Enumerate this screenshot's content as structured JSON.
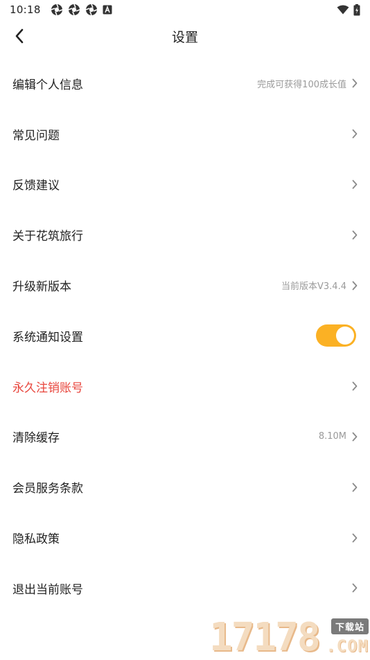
{
  "status_bar": {
    "time": "10:18",
    "left_icons": [
      "aperture-icon",
      "aperture-icon",
      "aperture-icon",
      "a-square-icon"
    ],
    "right_icons": [
      "wifi-icon",
      "battery-charging-icon"
    ]
  },
  "nav": {
    "title": "设置"
  },
  "rows": [
    {
      "label": "编辑个人信息",
      "value": "完成可获得100成长值",
      "type": "link"
    },
    {
      "label": "常见问题",
      "value": "",
      "type": "link"
    },
    {
      "label": "反馈建议",
      "value": "",
      "type": "link"
    },
    {
      "label": "关于花筑旅行",
      "value": "",
      "type": "link"
    },
    {
      "label": "升级新版本",
      "value": "当前版本V3.4.4",
      "type": "link"
    },
    {
      "label": "系统通知设置",
      "value": "",
      "type": "toggle",
      "toggle_on": true
    },
    {
      "label": "永久注销账号",
      "value": "",
      "type": "link",
      "danger": true
    },
    {
      "label": "清除缓存",
      "value": "8.10M",
      "type": "link"
    },
    {
      "label": "会员服务条款",
      "value": "",
      "type": "link"
    },
    {
      "label": "隐私政策",
      "value": "",
      "type": "link"
    },
    {
      "label": "退出当前账号",
      "value": "",
      "type": "link"
    }
  ],
  "watermark": {
    "digits": "17178",
    "badge": "下载站",
    "suffix": ".COM"
  },
  "colors": {
    "accent": "#fbb124",
    "danger": "#e8453c",
    "muted": "#9a9a9a"
  }
}
